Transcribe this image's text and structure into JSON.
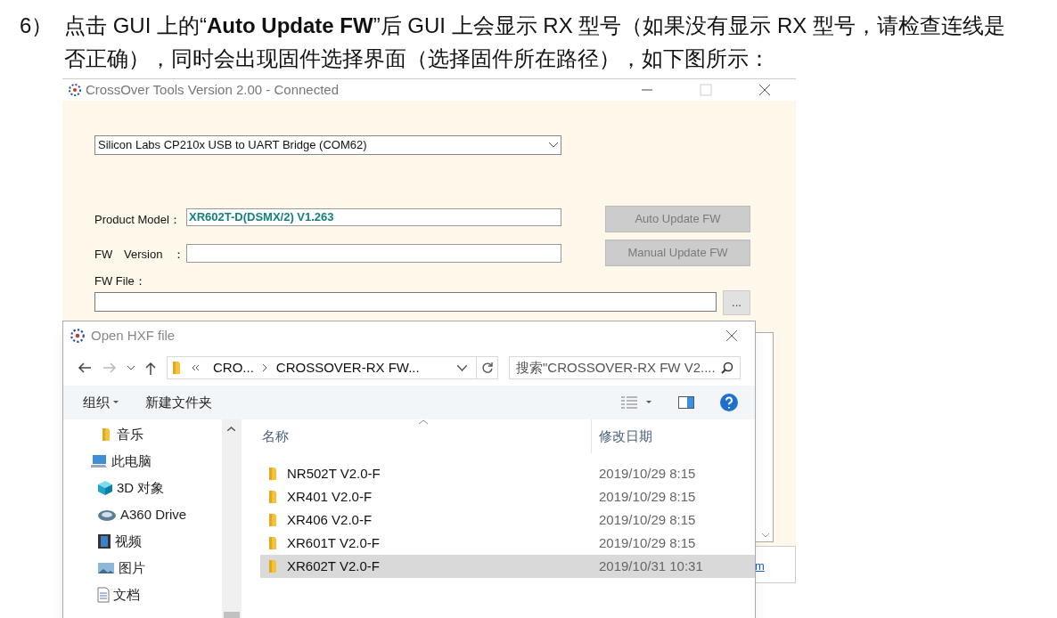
{
  "step": {
    "number": "6）",
    "text": "点击 GUI 上的“**Auto Update FW**”后 GUI 上会显示 RX 型号（如果没有显示 RX 型号，请检查连线是否正确），同时会出现固件选择界面（选择固件所在路径），如下图所示："
  },
  "main_window": {
    "title": "CrossOver Tools Version 2.00 - Connected",
    "port": "Silicon Labs CP210x USB to UART Bridge (COM62)",
    "product_model": {
      "label": "Product Model：",
      "value": "XR602T-D(DSMX/2) V1.263"
    },
    "fw_version": {
      "label_1": "FW",
      "label_2": "Version",
      "colon": "："
    },
    "fw_file": {
      "label": "FW File：",
      "browse": "..."
    },
    "buttons": [
      {
        "label": "Auto Update FW",
        "disabled": true
      },
      {
        "label": "Manual Update FW",
        "disabled": true
      }
    ],
    "link_fragment": "m"
  },
  "dialog": {
    "title": "Open HXF file",
    "path": [
      "CRO...",
      "CROSSOVER-RX FW..."
    ],
    "search": {
      "placeholder": "搜索\"CROSSOVER-RX FW V2...."
    },
    "toolbar": [
      "组织",
      "新建文件夹"
    ],
    "nav_items": [
      {
        "label": "音乐",
        "kind": "folder"
      },
      {
        "label": "此电脑",
        "kind": "computer",
        "children": [
          {
            "label": "3D 对象",
            "kind": "cube"
          },
          {
            "label": "A360 Drive",
            "kind": "drive"
          },
          {
            "label": "视频",
            "kind": "video"
          },
          {
            "label": "图片",
            "kind": "image"
          },
          {
            "label": "文档",
            "kind": "document"
          }
        ]
      }
    ],
    "columns": [
      "名称",
      "修改日期"
    ],
    "files": [
      {
        "name": "NR502T V2.0-F",
        "date": "2019/10/29 8:15",
        "selected": false
      },
      {
        "name": "XR401 V2.0-F",
        "date": "2019/10/29 8:15",
        "selected": false
      },
      {
        "name": "XR406 V2.0-F",
        "date": "2019/10/29 8:15",
        "selected": false
      },
      {
        "name": "XR601T V2.0-F",
        "date": "2019/10/29 8:15",
        "selected": false
      },
      {
        "name": "XR602T V2.0-F",
        "date": "2019/10/31 10:31",
        "selected": true
      }
    ]
  }
}
